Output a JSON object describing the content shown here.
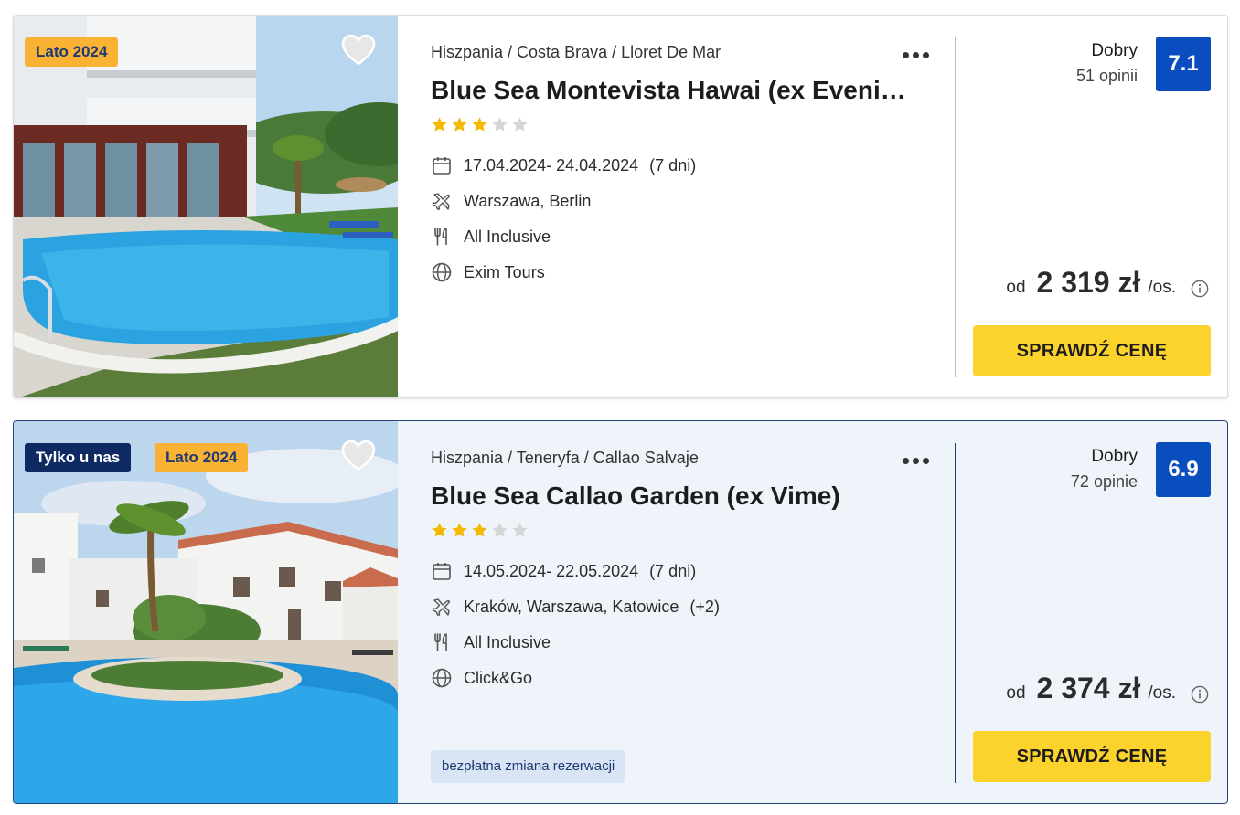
{
  "offers": [
    {
      "badges": [
        "Lato 2024"
      ],
      "breadcrumb": "Hiszpania / Costa Brava / Lloret De Mar",
      "title": "Blue Sea Montevista Hawai (ex Evenia Montevista Hawai)",
      "stars": {
        "filled": 3,
        "total": 5
      },
      "dates": "17.04.2024- 24.04.2024",
      "duration": "(7 dni)",
      "departures": "Warszawa, Berlin",
      "departures_extra": "",
      "board": "All Inclusive",
      "operator": "Exim Tours",
      "tag": "",
      "rating_label": "Dobry",
      "rating_count": "51 opinii",
      "score": "7.1",
      "price_prefix": "od",
      "price": "2 319 zł",
      "price_suffix": "/os.",
      "cta": "SPRAWDŹ CENĘ",
      "highlighted": false
    },
    {
      "badges": [
        "Tylko u nas",
        "Lato 2024"
      ],
      "breadcrumb": "Hiszpania / Teneryfa / Callao Salvaje",
      "title": "Blue Sea Callao Garden (ex Vime)",
      "stars": {
        "filled": 3,
        "total": 5
      },
      "dates": "14.05.2024- 22.05.2024",
      "duration": "(7 dni)",
      "departures": "Kraków, Warszawa, Katowice",
      "departures_extra": "(+2)",
      "board": "All Inclusive",
      "operator": "Click&Go",
      "tag": "bezpłatna zmiana rezerwacji",
      "rating_label": "Dobry",
      "rating_count": "72 opinie",
      "score": "6.9",
      "price_prefix": "od",
      "price": "2 374 zł",
      "price_suffix": "/os.",
      "cta": "SPRAWDŹ CENĘ",
      "highlighted": true
    }
  ],
  "icons": {
    "favorite": "heart-icon",
    "more": "more-dots-icon",
    "dates": "calendar-icon",
    "departures": "plane-icon",
    "board": "cutlery-icon",
    "operator": "globe-icon",
    "price_info": "info-icon"
  },
  "colors": {
    "badge_season": "#f9b233",
    "badge_exclusive": "#0f2a63",
    "score_bg": "#0a4dbe",
    "cta_bg": "#fcd22c",
    "star_filled": "#f5b800",
    "star_empty": "#d5d5d5",
    "highlight_border": "#24447e",
    "highlight_bg": "#eff4fa"
  }
}
